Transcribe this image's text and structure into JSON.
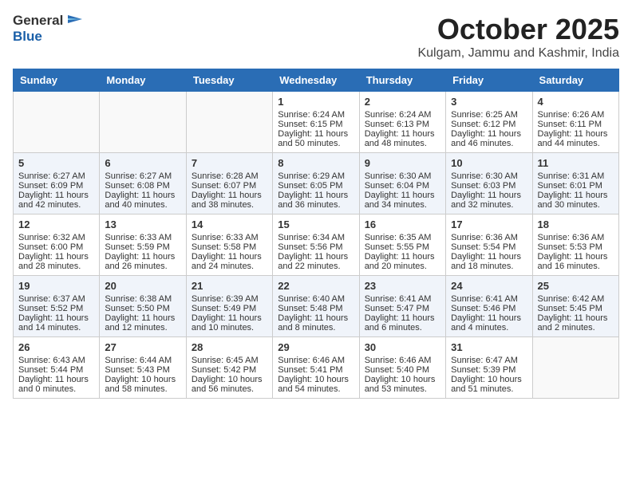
{
  "header": {
    "logo_general": "General",
    "logo_blue": "Blue",
    "month": "October 2025",
    "location": "Kulgam, Jammu and Kashmir, India"
  },
  "days_of_week": [
    "Sunday",
    "Monday",
    "Tuesday",
    "Wednesday",
    "Thursday",
    "Friday",
    "Saturday"
  ],
  "weeks": [
    {
      "cells": [
        {
          "day": "",
          "empty": true
        },
        {
          "day": "",
          "empty": true
        },
        {
          "day": "",
          "empty": true
        },
        {
          "day": "1",
          "sunrise": "6:24 AM",
          "sunset": "6:15 PM",
          "daylight": "11 hours and 50 minutes."
        },
        {
          "day": "2",
          "sunrise": "6:24 AM",
          "sunset": "6:13 PM",
          "daylight": "11 hours and 48 minutes."
        },
        {
          "day": "3",
          "sunrise": "6:25 AM",
          "sunset": "6:12 PM",
          "daylight": "11 hours and 46 minutes."
        },
        {
          "day": "4",
          "sunrise": "6:26 AM",
          "sunset": "6:11 PM",
          "daylight": "11 hours and 44 minutes."
        }
      ]
    },
    {
      "cells": [
        {
          "day": "5",
          "sunrise": "6:27 AM",
          "sunset": "6:09 PM",
          "daylight": "11 hours and 42 minutes."
        },
        {
          "day": "6",
          "sunrise": "6:27 AM",
          "sunset": "6:08 PM",
          "daylight": "11 hours and 40 minutes."
        },
        {
          "day": "7",
          "sunrise": "6:28 AM",
          "sunset": "6:07 PM",
          "daylight": "11 hours and 38 minutes."
        },
        {
          "day": "8",
          "sunrise": "6:29 AM",
          "sunset": "6:05 PM",
          "daylight": "11 hours and 36 minutes."
        },
        {
          "day": "9",
          "sunrise": "6:30 AM",
          "sunset": "6:04 PM",
          "daylight": "11 hours and 34 minutes."
        },
        {
          "day": "10",
          "sunrise": "6:30 AM",
          "sunset": "6:03 PM",
          "daylight": "11 hours and 32 minutes."
        },
        {
          "day": "11",
          "sunrise": "6:31 AM",
          "sunset": "6:01 PM",
          "daylight": "11 hours and 30 minutes."
        }
      ]
    },
    {
      "cells": [
        {
          "day": "12",
          "sunrise": "6:32 AM",
          "sunset": "6:00 PM",
          "daylight": "11 hours and 28 minutes."
        },
        {
          "day": "13",
          "sunrise": "6:33 AM",
          "sunset": "5:59 PM",
          "daylight": "11 hours and 26 minutes."
        },
        {
          "day": "14",
          "sunrise": "6:33 AM",
          "sunset": "5:58 PM",
          "daylight": "11 hours and 24 minutes."
        },
        {
          "day": "15",
          "sunrise": "6:34 AM",
          "sunset": "5:56 PM",
          "daylight": "11 hours and 22 minutes."
        },
        {
          "day": "16",
          "sunrise": "6:35 AM",
          "sunset": "5:55 PM",
          "daylight": "11 hours and 20 minutes."
        },
        {
          "day": "17",
          "sunrise": "6:36 AM",
          "sunset": "5:54 PM",
          "daylight": "11 hours and 18 minutes."
        },
        {
          "day": "18",
          "sunrise": "6:36 AM",
          "sunset": "5:53 PM",
          "daylight": "11 hours and 16 minutes."
        }
      ]
    },
    {
      "cells": [
        {
          "day": "19",
          "sunrise": "6:37 AM",
          "sunset": "5:52 PM",
          "daylight": "11 hours and 14 minutes."
        },
        {
          "day": "20",
          "sunrise": "6:38 AM",
          "sunset": "5:50 PM",
          "daylight": "11 hours and 12 minutes."
        },
        {
          "day": "21",
          "sunrise": "6:39 AM",
          "sunset": "5:49 PM",
          "daylight": "11 hours and 10 minutes."
        },
        {
          "day": "22",
          "sunrise": "6:40 AM",
          "sunset": "5:48 PM",
          "daylight": "11 hours and 8 minutes."
        },
        {
          "day": "23",
          "sunrise": "6:41 AM",
          "sunset": "5:47 PM",
          "daylight": "11 hours and 6 minutes."
        },
        {
          "day": "24",
          "sunrise": "6:41 AM",
          "sunset": "5:46 PM",
          "daylight": "11 hours and 4 minutes."
        },
        {
          "day": "25",
          "sunrise": "6:42 AM",
          "sunset": "5:45 PM",
          "daylight": "11 hours and 2 minutes."
        }
      ]
    },
    {
      "cells": [
        {
          "day": "26",
          "sunrise": "6:43 AM",
          "sunset": "5:44 PM",
          "daylight": "11 hours and 0 minutes."
        },
        {
          "day": "27",
          "sunrise": "6:44 AM",
          "sunset": "5:43 PM",
          "daylight": "10 hours and 58 minutes."
        },
        {
          "day": "28",
          "sunrise": "6:45 AM",
          "sunset": "5:42 PM",
          "daylight": "10 hours and 56 minutes."
        },
        {
          "day": "29",
          "sunrise": "6:46 AM",
          "sunset": "5:41 PM",
          "daylight": "10 hours and 54 minutes."
        },
        {
          "day": "30",
          "sunrise": "6:46 AM",
          "sunset": "5:40 PM",
          "daylight": "10 hours and 53 minutes."
        },
        {
          "day": "31",
          "sunrise": "6:47 AM",
          "sunset": "5:39 PM",
          "daylight": "10 hours and 51 minutes."
        },
        {
          "day": "",
          "empty": true
        }
      ]
    }
  ],
  "labels": {
    "sunrise": "Sunrise:",
    "sunset": "Sunset:",
    "daylight": "Daylight:"
  }
}
